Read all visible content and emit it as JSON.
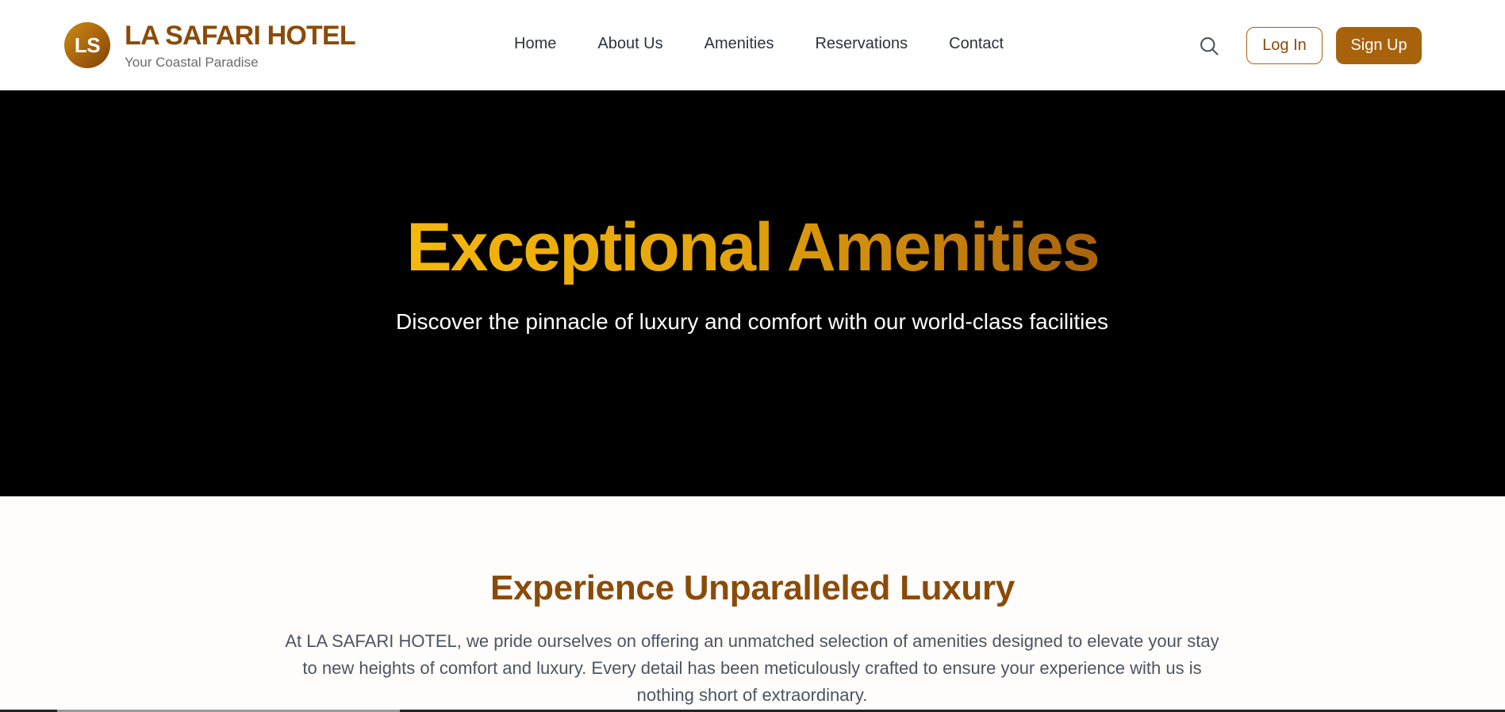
{
  "header": {
    "logo_initials": "LS",
    "brand_name": "LA SAFARI HOTEL",
    "tagline": "Your Coastal Paradise",
    "nav": [
      {
        "label": "Home"
      },
      {
        "label": "About Us"
      },
      {
        "label": "Amenities"
      },
      {
        "label": "Reservations"
      },
      {
        "label": "Contact"
      }
    ],
    "login_label": "Log In",
    "signup_label": "Sign Up"
  },
  "hero": {
    "title": "Exceptional Amenities",
    "subtitle": "Discover the pinnacle of luxury and comfort with our world-class facilities"
  },
  "intro": {
    "title": "Experience Unparalleled Luxury",
    "text": "At LA SAFARI HOTEL, we pride ourselves on offering an unmatched selection of amenities designed to elevate your stay to new heights of comfort and luxury. Every detail has been meticulously crafted to ensure your experience with us is nothing short of extraordinary."
  },
  "colors": {
    "brand": "#8b4b08",
    "accent": "#a8620c",
    "hero_gradient_start": "#f5b80a",
    "hero_background": "#000000"
  },
  "icons": {
    "search": "search-icon"
  }
}
